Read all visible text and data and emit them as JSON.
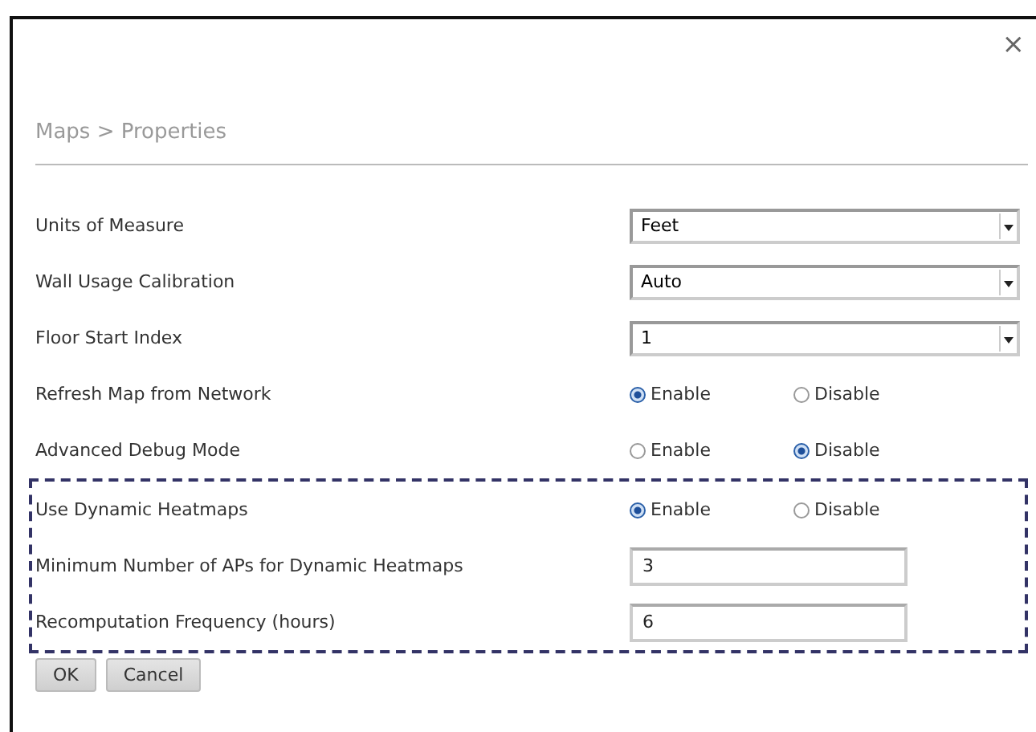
{
  "dialog": {
    "close": "×",
    "breadcrumb": "Maps > Properties"
  },
  "rows": [
    {
      "kind": "select",
      "label": "Units of Measure",
      "value": "Feet"
    },
    {
      "kind": "select",
      "label": "Wall Usage Calibration",
      "value": "Auto"
    },
    {
      "kind": "select",
      "label": "Floor Start Index",
      "value": "1"
    },
    {
      "kind": "radio",
      "label": "Refresh Map from Network",
      "options": [
        {
          "label": "Enable",
          "selected": true
        },
        {
          "label": "Disable",
          "selected": false
        }
      ]
    },
    {
      "kind": "radio",
      "label": "Advanced Debug Mode",
      "options": [
        {
          "label": "Enable",
          "selected": false
        },
        {
          "label": "Disable",
          "selected": true
        }
      ]
    }
  ],
  "highlighted_rows": [
    {
      "kind": "radio",
      "label": "Use Dynamic Heatmaps",
      "options": [
        {
          "label": "Enable",
          "selected": true
        },
        {
          "label": "Disable",
          "selected": false
        }
      ]
    },
    {
      "kind": "text",
      "label": "Minimum Number of APs for Dynamic Heatmaps",
      "value": "3"
    },
    {
      "kind": "text",
      "label": "Recomputation Frequency (hours)",
      "value": "6"
    }
  ],
  "buttons": [
    "OK",
    "Cancel"
  ]
}
